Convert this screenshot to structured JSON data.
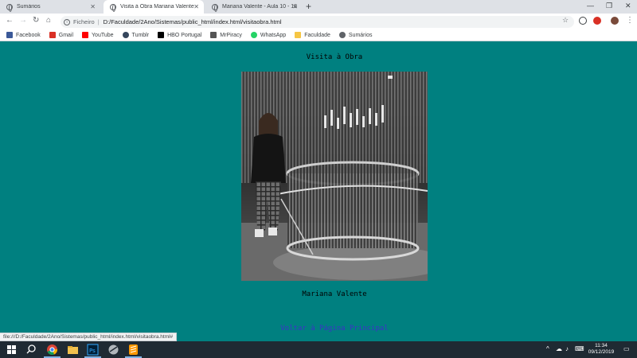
{
  "browser": {
    "tabs": [
      {
        "title": "Sumários",
        "active": false
      },
      {
        "title": "Visita à Obra Mariana Valente",
        "active": true
      },
      {
        "title": "Mariana Valente - Aula 10 - 18 d",
        "active": false
      }
    ],
    "new_tab": "+",
    "address": {
      "scheme_label": "Ficheiro",
      "url": "D:/Faculdade/2Ano/Sistemas/public_html/index.html/visitaobra.html"
    },
    "bookmarks": [
      {
        "label": "Facebook",
        "color": "#3b5998"
      },
      {
        "label": "Gmail",
        "color": "#d93025"
      },
      {
        "label": "YouTube",
        "color": "#ff0000"
      },
      {
        "label": "Tumblr",
        "color": "#35465c"
      },
      {
        "label": "HBO Portugal",
        "color": "#000000"
      },
      {
        "label": "MrPiracy",
        "color": "#555555"
      },
      {
        "label": "WhatsApp",
        "color": "#25d366"
      },
      {
        "label": "Faculdade",
        "color": "#f6c644"
      },
      {
        "label": "Sumários",
        "color": "#5f6368"
      }
    ]
  },
  "page": {
    "title": "Visita à Obra",
    "caption": "Mariana Valente",
    "back_link": "Voltar à Página Principal",
    "background": "#008080",
    "link_color": "#3c32c8"
  },
  "status_url": "file:///D:/Faculdade/2Ano/Sistemas/public_html/index.html/visitaobra.html#",
  "taskbar": {
    "time": "11:34",
    "date": "09/12/2019"
  }
}
